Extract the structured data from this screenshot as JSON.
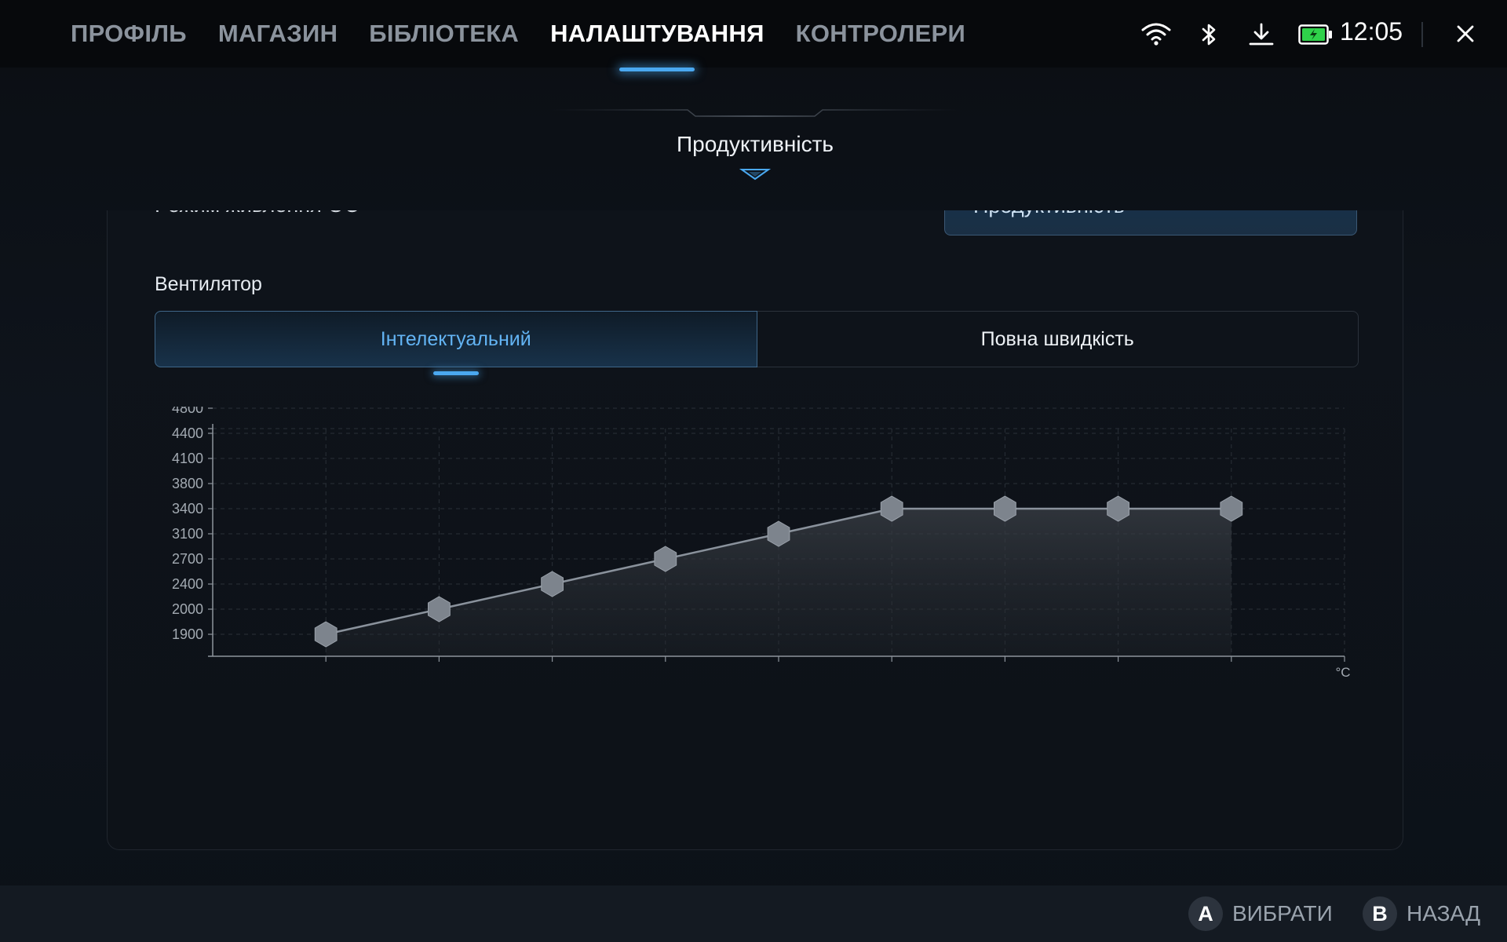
{
  "nav": {
    "tabs": [
      {
        "label": "ПРОФІЛЬ",
        "active": false
      },
      {
        "label": "МАГАЗИН",
        "active": false
      },
      {
        "label": "БІБЛІОТЕКА",
        "active": false
      },
      {
        "label": "НАЛАШТУВАННЯ",
        "active": true
      },
      {
        "label": "КОНТРОЛЕРИ",
        "active": false
      }
    ]
  },
  "status": {
    "time": "12:05",
    "icons": [
      "wifi-icon",
      "bluetooth-icon",
      "download-icon",
      "battery-charging-icon",
      "close-icon"
    ],
    "battery_color": "#2fd24a"
  },
  "section": {
    "title": "Продуктивність"
  },
  "clipped_row": {
    "label": "Режим живлення ОС",
    "dropdown_value": "Продуктивність"
  },
  "fan": {
    "label": "Вентилятор",
    "modes": [
      {
        "label": "Інтелектуальний",
        "active": true
      },
      {
        "label": "Повна швидкість",
        "active": false
      }
    ]
  },
  "colors": {
    "accent": "#4aa8f0",
    "active_text": "#63b4f4"
  },
  "chart_data": {
    "type": "area",
    "x_unit_label": "°C",
    "y_ticks": [
      1900,
      2000,
      2400,
      2700,
      3100,
      3400,
      3800,
      4100,
      4400,
      4800
    ],
    "x_ticks_count": 10,
    "points": [
      {
        "x_index": 1,
        "rpm": 1900
      },
      {
        "x_index": 2,
        "rpm": 2000
      },
      {
        "x_index": 3,
        "rpm": 2400
      },
      {
        "x_index": 4,
        "rpm": 2700
      },
      {
        "x_index": 5,
        "rpm": 3100
      },
      {
        "x_index": 6,
        "rpm": 3400
      },
      {
        "x_index": 7,
        "rpm": 3400
      },
      {
        "x_index": 8,
        "rpm": 3400
      },
      {
        "x_index": 9,
        "rpm": 3400
      }
    ],
    "grid": true,
    "line_color": "#8a929c",
    "marker_color": "#7d848d"
  },
  "bottom": {
    "hints": [
      {
        "key": "A",
        "label": "ВИБРАТИ"
      },
      {
        "key": "B",
        "label": "НАЗАД"
      }
    ]
  }
}
